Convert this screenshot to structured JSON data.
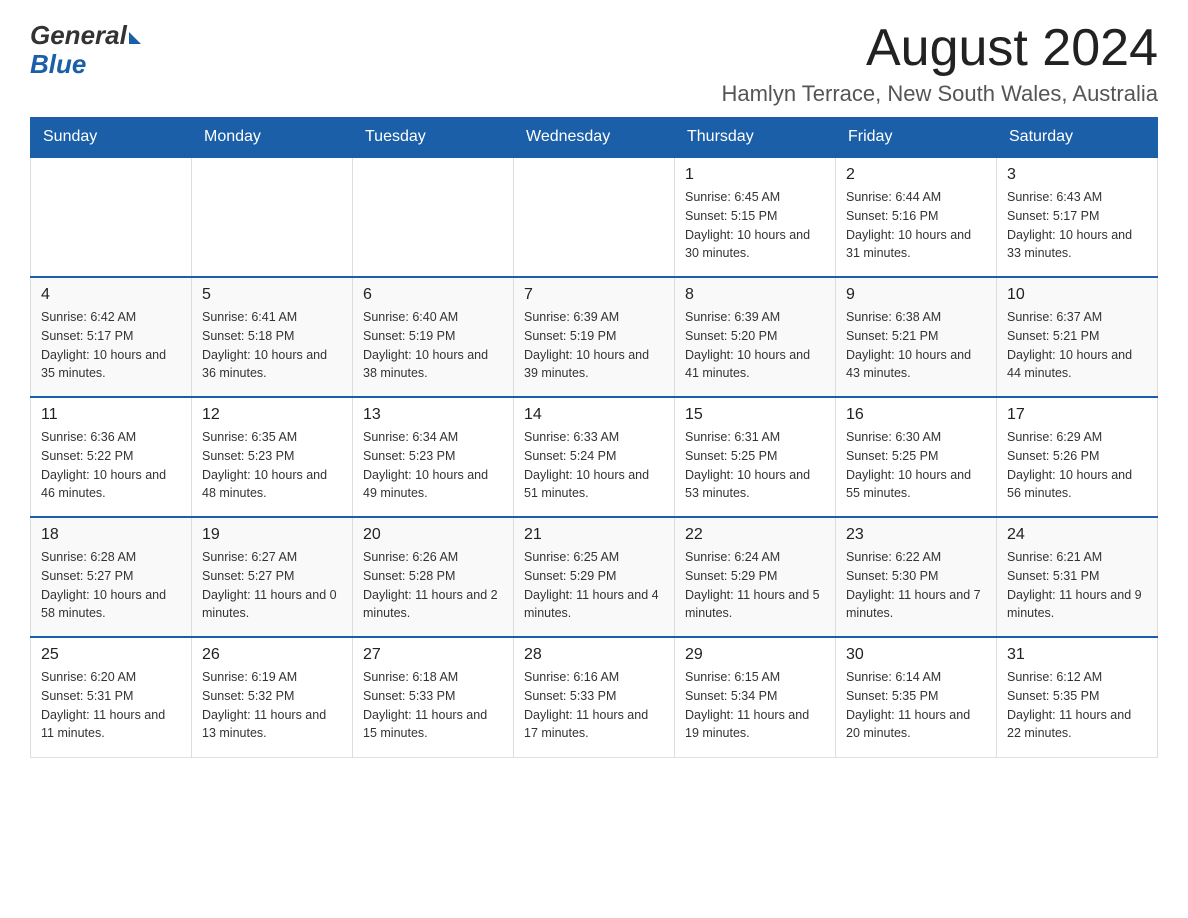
{
  "header": {
    "logo_general": "General",
    "logo_blue": "Blue",
    "title": "August 2024",
    "location": "Hamlyn Terrace, New South Wales, Australia"
  },
  "days_of_week": [
    "Sunday",
    "Monday",
    "Tuesday",
    "Wednesday",
    "Thursday",
    "Friday",
    "Saturday"
  ],
  "weeks": [
    [
      {
        "day": "",
        "info": ""
      },
      {
        "day": "",
        "info": ""
      },
      {
        "day": "",
        "info": ""
      },
      {
        "day": "",
        "info": ""
      },
      {
        "day": "1",
        "info": "Sunrise: 6:45 AM\nSunset: 5:15 PM\nDaylight: 10 hours and 30 minutes."
      },
      {
        "day": "2",
        "info": "Sunrise: 6:44 AM\nSunset: 5:16 PM\nDaylight: 10 hours and 31 minutes."
      },
      {
        "day": "3",
        "info": "Sunrise: 6:43 AM\nSunset: 5:17 PM\nDaylight: 10 hours and 33 minutes."
      }
    ],
    [
      {
        "day": "4",
        "info": "Sunrise: 6:42 AM\nSunset: 5:17 PM\nDaylight: 10 hours and 35 minutes."
      },
      {
        "day": "5",
        "info": "Sunrise: 6:41 AM\nSunset: 5:18 PM\nDaylight: 10 hours and 36 minutes."
      },
      {
        "day": "6",
        "info": "Sunrise: 6:40 AM\nSunset: 5:19 PM\nDaylight: 10 hours and 38 minutes."
      },
      {
        "day": "7",
        "info": "Sunrise: 6:39 AM\nSunset: 5:19 PM\nDaylight: 10 hours and 39 minutes."
      },
      {
        "day": "8",
        "info": "Sunrise: 6:39 AM\nSunset: 5:20 PM\nDaylight: 10 hours and 41 minutes."
      },
      {
        "day": "9",
        "info": "Sunrise: 6:38 AM\nSunset: 5:21 PM\nDaylight: 10 hours and 43 minutes."
      },
      {
        "day": "10",
        "info": "Sunrise: 6:37 AM\nSunset: 5:21 PM\nDaylight: 10 hours and 44 minutes."
      }
    ],
    [
      {
        "day": "11",
        "info": "Sunrise: 6:36 AM\nSunset: 5:22 PM\nDaylight: 10 hours and 46 minutes."
      },
      {
        "day": "12",
        "info": "Sunrise: 6:35 AM\nSunset: 5:23 PM\nDaylight: 10 hours and 48 minutes."
      },
      {
        "day": "13",
        "info": "Sunrise: 6:34 AM\nSunset: 5:23 PM\nDaylight: 10 hours and 49 minutes."
      },
      {
        "day": "14",
        "info": "Sunrise: 6:33 AM\nSunset: 5:24 PM\nDaylight: 10 hours and 51 minutes."
      },
      {
        "day": "15",
        "info": "Sunrise: 6:31 AM\nSunset: 5:25 PM\nDaylight: 10 hours and 53 minutes."
      },
      {
        "day": "16",
        "info": "Sunrise: 6:30 AM\nSunset: 5:25 PM\nDaylight: 10 hours and 55 minutes."
      },
      {
        "day": "17",
        "info": "Sunrise: 6:29 AM\nSunset: 5:26 PM\nDaylight: 10 hours and 56 minutes."
      }
    ],
    [
      {
        "day": "18",
        "info": "Sunrise: 6:28 AM\nSunset: 5:27 PM\nDaylight: 10 hours and 58 minutes."
      },
      {
        "day": "19",
        "info": "Sunrise: 6:27 AM\nSunset: 5:27 PM\nDaylight: 11 hours and 0 minutes."
      },
      {
        "day": "20",
        "info": "Sunrise: 6:26 AM\nSunset: 5:28 PM\nDaylight: 11 hours and 2 minutes."
      },
      {
        "day": "21",
        "info": "Sunrise: 6:25 AM\nSunset: 5:29 PM\nDaylight: 11 hours and 4 minutes."
      },
      {
        "day": "22",
        "info": "Sunrise: 6:24 AM\nSunset: 5:29 PM\nDaylight: 11 hours and 5 minutes."
      },
      {
        "day": "23",
        "info": "Sunrise: 6:22 AM\nSunset: 5:30 PM\nDaylight: 11 hours and 7 minutes."
      },
      {
        "day": "24",
        "info": "Sunrise: 6:21 AM\nSunset: 5:31 PM\nDaylight: 11 hours and 9 minutes."
      }
    ],
    [
      {
        "day": "25",
        "info": "Sunrise: 6:20 AM\nSunset: 5:31 PM\nDaylight: 11 hours and 11 minutes."
      },
      {
        "day": "26",
        "info": "Sunrise: 6:19 AM\nSunset: 5:32 PM\nDaylight: 11 hours and 13 minutes."
      },
      {
        "day": "27",
        "info": "Sunrise: 6:18 AM\nSunset: 5:33 PM\nDaylight: 11 hours and 15 minutes."
      },
      {
        "day": "28",
        "info": "Sunrise: 6:16 AM\nSunset: 5:33 PM\nDaylight: 11 hours and 17 minutes."
      },
      {
        "day": "29",
        "info": "Sunrise: 6:15 AM\nSunset: 5:34 PM\nDaylight: 11 hours and 19 minutes."
      },
      {
        "day": "30",
        "info": "Sunrise: 6:14 AM\nSunset: 5:35 PM\nDaylight: 11 hours and 20 minutes."
      },
      {
        "day": "31",
        "info": "Sunrise: 6:12 AM\nSunset: 5:35 PM\nDaylight: 11 hours and 22 minutes."
      }
    ]
  ]
}
